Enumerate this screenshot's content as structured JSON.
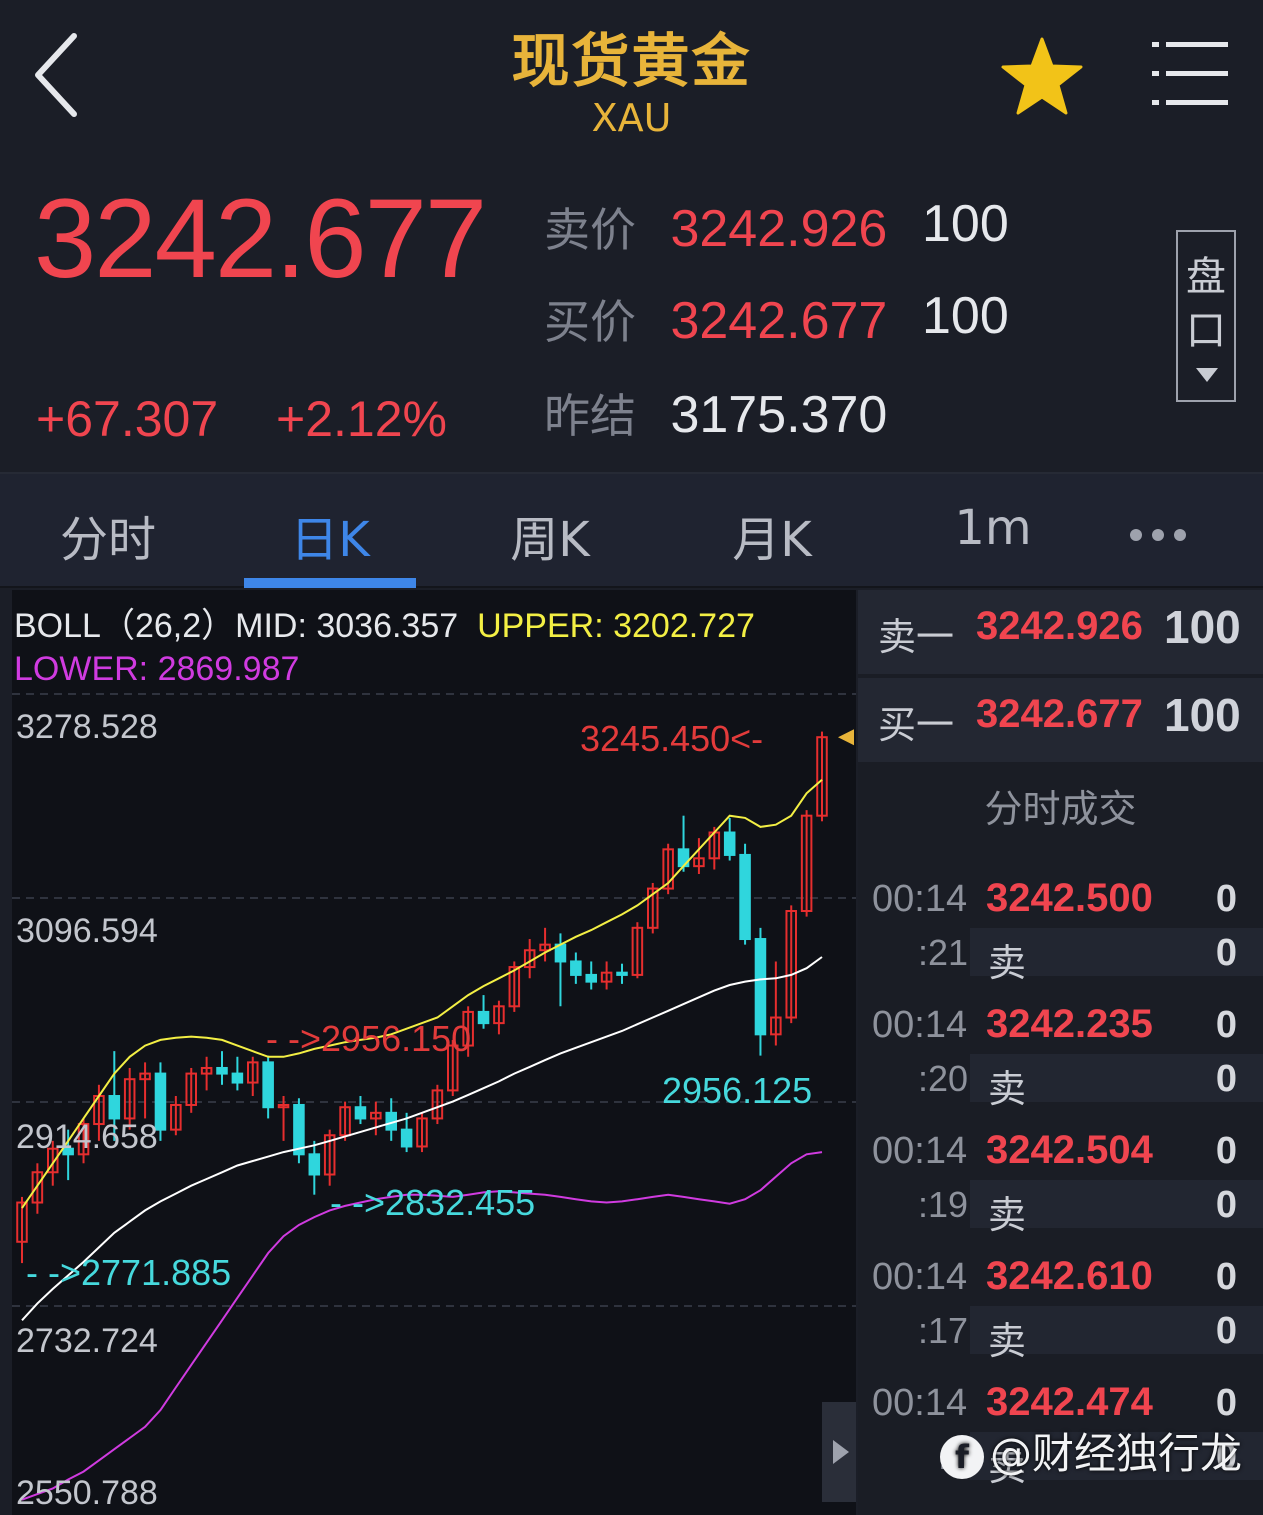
{
  "header": {
    "title": "现货黄金",
    "symbol": "XAU"
  },
  "quote": {
    "price": "3242.677",
    "change": "+67.307",
    "change_pct": "+2.12%",
    "ask_label": "卖价",
    "ask_price": "3242.926",
    "ask_vol": "100",
    "bid_label": "买价",
    "bid_price": "3242.677",
    "bid_vol": "100",
    "prev_label": "昨结",
    "prev_value": "3175.370",
    "pankou_label_1": "盘",
    "pankou_label_2": "口"
  },
  "tabs": [
    {
      "label": "分时",
      "active": false
    },
    {
      "label": "日K",
      "active": true
    },
    {
      "label": "周K",
      "active": false
    },
    {
      "label": "月K",
      "active": false
    },
    {
      "label": "1m",
      "active": false
    }
  ],
  "chart_data": {
    "type": "candlestick",
    "indicator": {
      "name": "BOLL（26,2）",
      "mid_label": "MID: 3036.357",
      "upper_label": "UPPER: 3202.727",
      "lower_label": "LOWER: 2869.987"
    },
    "y_ticks": [
      "3278.528",
      "3096.594",
      "2914.658",
      "2732.724",
      "2550.788"
    ],
    "ylim": [
      2550.788,
      3278.528
    ],
    "annotations": {
      "high": "3245.450<-",
      "mid_high": "- ->2956.150",
      "low_1": "- ->2771.885",
      "low_2": "- ->2832.455",
      "low_3": "2956.125"
    },
    "candles": [
      {
        "o": 2790,
        "h": 2830,
        "l": 2771,
        "c": 2825
      },
      {
        "o": 2825,
        "h": 2860,
        "l": 2815,
        "c": 2852
      },
      {
        "o": 2852,
        "h": 2880,
        "l": 2840,
        "c": 2873
      },
      {
        "o": 2873,
        "h": 2890,
        "l": 2845,
        "c": 2868
      },
      {
        "o": 2868,
        "h": 2900,
        "l": 2860,
        "c": 2895
      },
      {
        "o": 2895,
        "h": 2930,
        "l": 2880,
        "c": 2920
      },
      {
        "o": 2920,
        "h": 2960,
        "l": 2880,
        "c": 2900
      },
      {
        "o": 2900,
        "h": 2945,
        "l": 2890,
        "c": 2935
      },
      {
        "o": 2935,
        "h": 2950,
        "l": 2900,
        "c": 2940
      },
      {
        "o": 2940,
        "h": 2950,
        "l": 2880,
        "c": 2890
      },
      {
        "o": 2890,
        "h": 2920,
        "l": 2885,
        "c": 2912
      },
      {
        "o": 2912,
        "h": 2945,
        "l": 2905,
        "c": 2940
      },
      {
        "o": 2940,
        "h": 2955,
        "l": 2925,
        "c": 2945
      },
      {
        "o": 2945,
        "h": 2960,
        "l": 2930,
        "c": 2940
      },
      {
        "o": 2940,
        "h": 2955,
        "l": 2925,
        "c": 2932
      },
      {
        "o": 2932,
        "h": 2955,
        "l": 2920,
        "c": 2950
      },
      {
        "o": 2950,
        "h": 2956,
        "l": 2900,
        "c": 2910
      },
      {
        "o": 2910,
        "h": 2920,
        "l": 2880,
        "c": 2912
      },
      {
        "o": 2912,
        "h": 2918,
        "l": 2860,
        "c": 2868
      },
      {
        "o": 2868,
        "h": 2880,
        "l": 2832,
        "c": 2850
      },
      {
        "o": 2850,
        "h": 2890,
        "l": 2840,
        "c": 2885
      },
      {
        "o": 2885,
        "h": 2915,
        "l": 2880,
        "c": 2910
      },
      {
        "o": 2910,
        "h": 2920,
        "l": 2895,
        "c": 2900
      },
      {
        "o": 2900,
        "h": 2915,
        "l": 2885,
        "c": 2905
      },
      {
        "o": 2905,
        "h": 2918,
        "l": 2880,
        "c": 2890
      },
      {
        "o": 2890,
        "h": 2905,
        "l": 2870,
        "c": 2875
      },
      {
        "o": 2875,
        "h": 2905,
        "l": 2870,
        "c": 2900
      },
      {
        "o": 2900,
        "h": 2930,
        "l": 2895,
        "c": 2925
      },
      {
        "o": 2925,
        "h": 2970,
        "l": 2920,
        "c": 2965
      },
      {
        "o": 2965,
        "h": 3000,
        "l": 2955,
        "c": 2995
      },
      {
        "o": 2995,
        "h": 3010,
        "l": 2980,
        "c": 2985
      },
      {
        "o": 2985,
        "h": 3005,
        "l": 2975,
        "c": 3000
      },
      {
        "o": 3000,
        "h": 3040,
        "l": 2995,
        "c": 3035
      },
      {
        "o": 3035,
        "h": 3060,
        "l": 3025,
        "c": 3050
      },
      {
        "o": 3050,
        "h": 3070,
        "l": 3040,
        "c": 3055
      },
      {
        "o": 3055,
        "h": 3065,
        "l": 3000,
        "c": 3040
      },
      {
        "o": 3040,
        "h": 3048,
        "l": 3020,
        "c": 3028
      },
      {
        "o": 3028,
        "h": 3040,
        "l": 3015,
        "c": 3022
      },
      {
        "o": 3022,
        "h": 3040,
        "l": 3015,
        "c": 3030
      },
      {
        "o": 3030,
        "h": 3038,
        "l": 3020,
        "c": 3028
      },
      {
        "o": 3028,
        "h": 3075,
        "l": 3025,
        "c": 3070
      },
      {
        "o": 3070,
        "h": 3110,
        "l": 3065,
        "c": 3105
      },
      {
        "o": 3105,
        "h": 3145,
        "l": 3100,
        "c": 3140
      },
      {
        "o": 3140,
        "h": 3170,
        "l": 3120,
        "c": 3125
      },
      {
        "o": 3125,
        "h": 3150,
        "l": 3118,
        "c": 3132
      },
      {
        "o": 3132,
        "h": 3160,
        "l": 3122,
        "c": 3155
      },
      {
        "o": 3155,
        "h": 3168,
        "l": 3130,
        "c": 3135
      },
      {
        "o": 3135,
        "h": 3145,
        "l": 3055,
        "c": 3060
      },
      {
        "o": 3060,
        "h": 3070,
        "l": 2956,
        "c": 2975
      },
      {
        "o": 2975,
        "h": 3040,
        "l": 2965,
        "c": 2990
      },
      {
        "o": 2990,
        "h": 3090,
        "l": 2985,
        "c": 3085
      },
      {
        "o": 3085,
        "h": 3175,
        "l": 3080,
        "c": 3170
      },
      {
        "o": 3170,
        "h": 3245,
        "l": 3165,
        "c": 3240
      }
    ],
    "upper": [
      2820,
      2840,
      2860,
      2880,
      2900,
      2920,
      2940,
      2955,
      2965,
      2970,
      2972,
      2973,
      2972,
      2970,
      2965,
      2960,
      2955,
      2955,
      2958,
      2962,
      2965,
      2968,
      2970,
      2972,
      2975,
      2980,
      2985,
      2990,
      3000,
      3010,
      3018,
      3025,
      3032,
      3040,
      3048,
      3055,
      3062,
      3068,
      3075,
      3082,
      3090,
      3100,
      3110,
      3125,
      3140,
      3155,
      3170,
      3168,
      3160,
      3162,
      3170,
      3190,
      3202
    ],
    "mid": [
      2720,
      2735,
      2748,
      2760,
      2772,
      2785,
      2798,
      2808,
      2818,
      2826,
      2833,
      2840,
      2846,
      2852,
      2858,
      2862,
      2866,
      2870,
      2873,
      2876,
      2880,
      2884,
      2888,
      2892,
      2896,
      2900,
      2905,
      2910,
      2915,
      2921,
      2927,
      2933,
      2940,
      2946,
      2952,
      2958,
      2963,
      2968,
      2973,
      2978,
      2984,
      2990,
      2996,
      3002,
      3008,
      3014,
      3019,
      3022,
      3024,
      3025,
      3028,
      3034,
      3044
    ],
    "lower": [
      2560,
      2565,
      2570,
      2578,
      2585,
      2595,
      2605,
      2615,
      2625,
      2640,
      2660,
      2680,
      2700,
      2720,
      2740,
      2760,
      2780,
      2795,
      2805,
      2812,
      2818,
      2822,
      2825,
      2828,
      2830,
      2832,
      2832,
      2831,
      2830,
      2832,
      2834,
      2835,
      2834,
      2833,
      2832,
      2830,
      2828,
      2826,
      2825,
      2826,
      2828,
      2830,
      2832,
      2830,
      2828,
      2826,
      2824,
      2828,
      2836,
      2848,
      2860,
      2868,
      2870
    ]
  },
  "orderbook": {
    "sell_label": "卖一",
    "sell_price": "3242.926",
    "sell_vol": "100",
    "buy_label": "买一",
    "buy_price": "3242.677",
    "buy_vol": "100"
  },
  "timesales": {
    "title": "分时成交",
    "rows": [
      {
        "time": "00:14",
        "sec": ":21",
        "price": "3242.500",
        "side": "卖",
        "v1": "0",
        "v2": "0"
      },
      {
        "time": "00:14",
        "sec": ":20",
        "price": "3242.235",
        "side": "卖",
        "v1": "0",
        "v2": "0"
      },
      {
        "time": "00:14",
        "sec": ":19",
        "price": "3242.504",
        "side": "卖",
        "v1": "0",
        "v2": "0"
      },
      {
        "time": "00:14",
        "sec": ":17",
        "price": "3242.610",
        "side": "卖",
        "v1": "0",
        "v2": "0"
      },
      {
        "time": "00:14",
        "sec": ":1",
        "price": "3242.474",
        "side": "卖",
        "v1": "0",
        "v2": "0"
      }
    ]
  },
  "watermark": "@财经独行龙",
  "colors": {
    "up": "#e62e2e",
    "down": "#2fd6dd",
    "upper": "#f3ef44",
    "mid": "#ffffff",
    "lower": "#d03be0",
    "accent": "#3e86e8",
    "gold": "#e8b43a"
  }
}
